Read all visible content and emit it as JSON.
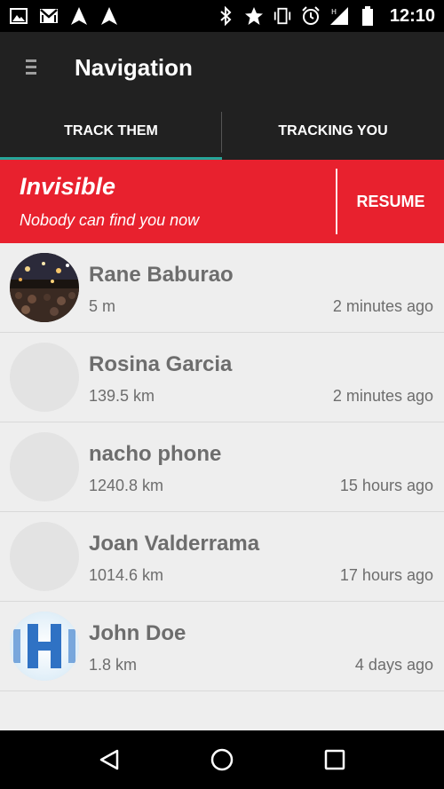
{
  "status_bar": {
    "time": "12:10",
    "left_icons": [
      "image-icon",
      "gmail-icon",
      "navigation-icon",
      "navigation-icon"
    ],
    "right_icons": [
      "bluetooth-icon",
      "star-icon",
      "vibrate-icon",
      "alarm-icon",
      "signal-icon",
      "battery-icon"
    ]
  },
  "app_bar": {
    "title": "Navigation",
    "menu_icon": "hamburger-menu-icon"
  },
  "tabs": [
    {
      "label": "TRACK THEM",
      "active": true
    },
    {
      "label": "TRACKING YOU",
      "active": false
    }
  ],
  "banner": {
    "title": "Invisible",
    "subtitle": "Nobody can find you now",
    "button": "RESUME",
    "color": "#e8212e"
  },
  "contacts": [
    {
      "name": "Rane Baburao",
      "distance": "5 m",
      "time": "2 minutes ago",
      "avatar": "photo-night-crowd"
    },
    {
      "name": "Rosina Garcia",
      "distance": "139.5 km",
      "time": "2 minutes ago",
      "avatar": "placeholder"
    },
    {
      "name": "nacho phone",
      "distance": "1240.8 km",
      "time": "15 hours ago",
      "avatar": "placeholder"
    },
    {
      "name": "Joan Valderrama",
      "distance": "1014.6 km",
      "time": "17 hours ago",
      "avatar": "placeholder"
    },
    {
      "name": "John Doe",
      "distance": "1.8 km",
      "time": "4 days ago",
      "avatar": "letter-H-blue"
    }
  ],
  "nav_bar": {
    "buttons": [
      "back-icon",
      "home-icon",
      "recents-icon"
    ]
  },
  "colors": {
    "accent_tab": "#26a69a",
    "appbar": "#212121",
    "text_gray": "#6d6d6d"
  }
}
